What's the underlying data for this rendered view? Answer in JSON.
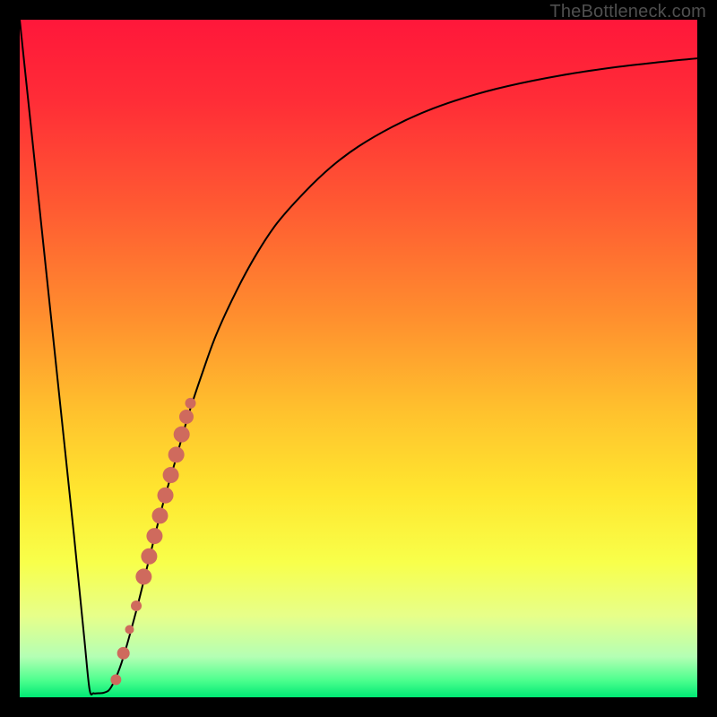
{
  "caption": "TheBottleneck.com",
  "colors": {
    "frame": "#000000",
    "curve_stroke": "#000000",
    "marker_fill": "#cf6a5d",
    "gradient_stops": [
      {
        "offset": 0.0,
        "color": "#ff173a"
      },
      {
        "offset": 0.12,
        "color": "#ff2d37"
      },
      {
        "offset": 0.28,
        "color": "#ff5b32"
      },
      {
        "offset": 0.44,
        "color": "#ff8f2e"
      },
      {
        "offset": 0.58,
        "color": "#ffc22d"
      },
      {
        "offset": 0.7,
        "color": "#ffe72f"
      },
      {
        "offset": 0.8,
        "color": "#f8ff4a"
      },
      {
        "offset": 0.88,
        "color": "#e7ff8a"
      },
      {
        "offset": 0.94,
        "color": "#b4ffb4"
      },
      {
        "offset": 0.975,
        "color": "#4dff8e"
      },
      {
        "offset": 1.0,
        "color": "#00e874"
      }
    ]
  },
  "chart_data": {
    "type": "line",
    "title": "",
    "xlabel": "",
    "ylabel": "",
    "xlim": [
      0,
      100
    ],
    "ylim": [
      0,
      100
    ],
    "series": [
      {
        "name": "bottleneck-curve",
        "x": [
          0.0,
          2.0,
          4.0,
          6.0,
          8.0,
          9.5,
          10.3,
          10.9,
          11.5,
          12.5,
          13.5,
          15.0,
          17.0,
          19.0,
          21.0,
          23.0,
          25.0,
          27.0,
          29.0,
          32.0,
          35.0,
          38.0,
          42.0,
          46.0,
          50.0,
          55.0,
          60.0,
          66.0,
          72.0,
          80.0,
          88.0,
          95.0,
          100.0
        ],
        "y": [
          100.0,
          81.0,
          62.0,
          43.0,
          24.0,
          9.0,
          1.2,
          0.6,
          0.6,
          0.7,
          1.5,
          5.0,
          12.0,
          20.0,
          28.0,
          35.0,
          42.0,
          48.0,
          53.5,
          60.0,
          65.5,
          70.0,
          74.5,
          78.3,
          81.3,
          84.2,
          86.5,
          88.6,
          90.2,
          91.8,
          93.0,
          93.8,
          94.3
        ]
      }
    ],
    "markers": [
      {
        "x": 14.2,
        "y": 2.6,
        "r": 6
      },
      {
        "x": 15.3,
        "y": 6.5,
        "r": 7
      },
      {
        "x": 16.2,
        "y": 10.0,
        "r": 5
      },
      {
        "x": 17.2,
        "y": 13.5,
        "r": 6
      },
      {
        "x": 18.3,
        "y": 17.8,
        "r": 9
      },
      {
        "x": 19.1,
        "y": 20.8,
        "r": 9
      },
      {
        "x": 19.9,
        "y": 23.8,
        "r": 9
      },
      {
        "x": 20.7,
        "y": 26.8,
        "r": 9
      },
      {
        "x": 21.5,
        "y": 29.8,
        "r": 9
      },
      {
        "x": 22.3,
        "y": 32.8,
        "r": 9
      },
      {
        "x": 23.1,
        "y": 35.8,
        "r": 9
      },
      {
        "x": 23.9,
        "y": 38.8,
        "r": 9
      },
      {
        "x": 24.6,
        "y": 41.4,
        "r": 8
      },
      {
        "x": 25.2,
        "y": 43.4,
        "r": 6
      }
    ]
  }
}
